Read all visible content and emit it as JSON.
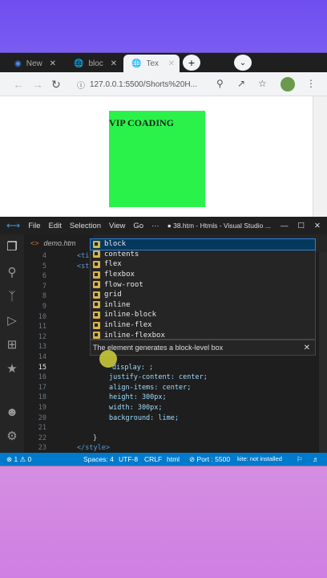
{
  "browser": {
    "tabs": [
      {
        "label": "New"
      },
      {
        "label": "bloc"
      },
      {
        "label": "Tex"
      }
    ],
    "url": "127.0.0.1:5500/Shorts%20H...",
    "page_text": "VIP COADING",
    "box_color": "#2bf24a"
  },
  "vscode": {
    "menu": [
      "File",
      "Edit",
      "Selection",
      "View",
      "Go",
      "···"
    ],
    "title": "● 38.htm - Htmls - Visual Studio ...",
    "editor_tab": "demo.htm",
    "line_numbers": [
      "4",
      "5",
      "6",
      "7",
      "8",
      "9",
      "10",
      "11",
      "12",
      "13",
      "14",
      "15",
      "16",
      "17",
      "18",
      "19",
      "20",
      "21",
      "22",
      "23"
    ],
    "current_line": "15",
    "code_lines": {
      "l4": "<ti",
      "l5": "<st",
      "l15": "display: ;",
      "l16": "justify-content: center;",
      "l17": "align-items: center;",
      "l18": "height: 300px;",
      "l19": "width: 300px;",
      "l20": "background: lime;",
      "l22": "}",
      "l23": "</style>"
    },
    "suggestions": [
      "block",
      "contents",
      "flex",
      "flexbox",
      "flow-root",
      "grid",
      "inline",
      "inline-block",
      "inline-flex",
      "inline-flexbox"
    ],
    "suggestion_doc": "The element generates a block-level box",
    "status": {
      "errors": "⊗ 1 ⚠ 0",
      "spaces": "Spaces: 4",
      "encoding": "UTF-8",
      "eol": "CRLF",
      "language": "html",
      "port": "⊘ Port : 5500",
      "kite": "kite: not installed"
    },
    "accent": "#007acc"
  }
}
